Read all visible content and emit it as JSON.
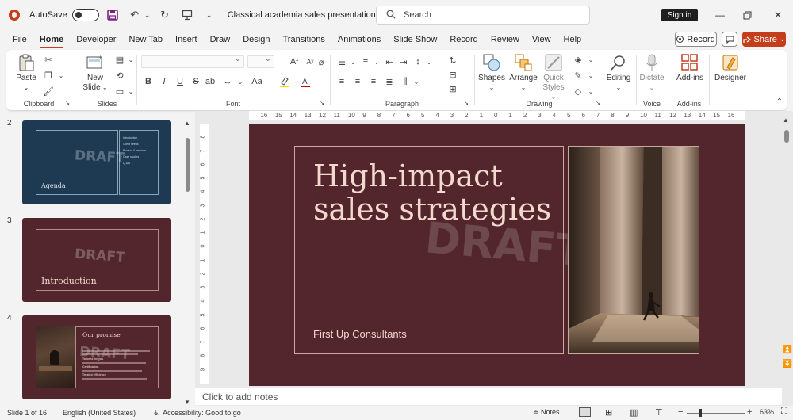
{
  "titlebar": {
    "autosave_label": "AutoSave",
    "doc_title": "Classical academia sales presentation  -  PowerP...",
    "search_placeholder": "Search",
    "sign_in": "Sign in"
  },
  "tabs": [
    "File",
    "Home",
    "Developer",
    "New Tab",
    "Insert",
    "Draw",
    "Design",
    "Transitions",
    "Animations",
    "Slide Show",
    "Record",
    "Review",
    "View",
    "Help"
  ],
  "active_tab": "Home",
  "actions": {
    "record": "Record",
    "share": "Share"
  },
  "ribbon": {
    "clipboard": {
      "label": "Clipboard",
      "paste": "Paste"
    },
    "slides": {
      "label": "Slides",
      "new_slide_line1": "New",
      "new_slide_line2": "Slide"
    },
    "font": {
      "label": "Font",
      "bold": "B",
      "italic": "I",
      "underline": "U",
      "strike": "S",
      "font_size_up": "A",
      "font_size_down": "A",
      "case": "Aa"
    },
    "paragraph": {
      "label": "Paragraph"
    },
    "drawing": {
      "label": "Drawing",
      "shapes": "Shapes",
      "arrange": "Arrange",
      "quick_styles_line1": "Quick",
      "quick_styles_line2": "Styles"
    },
    "editing": {
      "label": "Editing"
    },
    "voice": {
      "label": "Voice",
      "dictate": "Dictate"
    },
    "addins": {
      "label": "Add-ins",
      "button": "Add-ins"
    },
    "designer": {
      "label": "Designer"
    }
  },
  "thumbnails": [
    {
      "number": "2",
      "title": "Agenda",
      "watermark": "DRAFT",
      "items": [
        "Introduction",
        "Client needs",
        "Product & services",
        "Case studies",
        "Q & A"
      ]
    },
    {
      "number": "3",
      "title": "Introduction",
      "watermark": "DRAFT"
    },
    {
      "number": "4",
      "title": "Our promise",
      "watermark": "DRAFT",
      "bold_items": [
        "Tailored for you",
        "Certification",
        "Trusted efficiency"
      ]
    }
  ],
  "ruler_ticks": [
    "16",
    "15",
    "14",
    "13",
    "12",
    "11",
    "10",
    "9",
    "8",
    "7",
    "6",
    "5",
    "4",
    "3",
    "2",
    "1",
    "0",
    "1",
    "2",
    "3",
    "4",
    "5",
    "6",
    "7",
    "8",
    "9",
    "10",
    "11",
    "12",
    "13",
    "14",
    "15",
    "16"
  ],
  "ruler_v_ticks": [
    "8",
    "7",
    "6",
    "5",
    "4",
    "3",
    "2",
    "1",
    "0",
    "1",
    "2",
    "3",
    "4",
    "5",
    "6",
    "7",
    "8",
    "9"
  ],
  "slide": {
    "title_line1": "High-impact",
    "title_line2": "sales strategies",
    "subtitle": "First Up Consultants",
    "watermark": "DRAFT",
    "background_color": "#52262c",
    "text_color": "#f2d8cd"
  },
  "notes_placeholder": "Click to add notes",
  "statusbar": {
    "slide_info": "Slide 1 of 16",
    "language": "English (United States)",
    "accessibility": "Accessibility: Good to go",
    "notes": "Notes",
    "zoom": "63%"
  },
  "colors": {
    "accent": "#c43e1c",
    "thumb2_bg": "#1e3a52",
    "thumb3_bg": "#52262c",
    "thumb4_bg": "#52262c"
  }
}
